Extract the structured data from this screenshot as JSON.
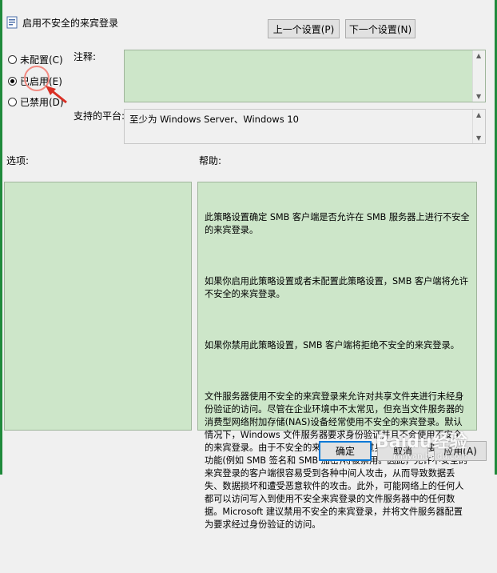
{
  "window": {
    "title": "启用不安全的来宾登录"
  },
  "nav": {
    "prev_label": "上一个设置(P)",
    "next_label": "下一个设置(N)"
  },
  "state": {
    "options": [
      {
        "label": "未配置(C)",
        "checked": false
      },
      {
        "label": "已启用(E)",
        "checked": true
      },
      {
        "label": "已禁用(D)",
        "checked": false
      }
    ]
  },
  "comment": {
    "label": "注释:"
  },
  "platform": {
    "label": "支持的平台:",
    "value": "至少为 Windows Server、Windows 10"
  },
  "options_section": {
    "label": "选项:"
  },
  "help_section": {
    "label": "帮助:",
    "paragraphs": [
      "此策略设置确定 SMB 客户端是否允许在 SMB 服务器上进行不安全的来宾登录。",
      "如果你启用此策略设置或者未配置此策略设置，SMB 客户端将允许不安全的来宾登录。",
      "如果你禁用此策略设置，SMB 客户端将拒绝不安全的来宾登录。",
      "文件服务器使用不安全的来宾登录来允许对共享文件夹进行未经身份验证的访问。尽管在企业环境中不太常见，但充当文件服务器的消费型网络附加存储(NAS)设备经常使用不安全的来宾登录。默认情况下，Windows 文件服务器要求身份验证并且不会使用不安全的来宾登录。由于不安全的来宾登录未经过身份验证，重要的安全功能(例如 SMB 签名和 SMB 加密)将被禁用。因此，允许不安全的来宾登录的客户端很容易受到各种中间人攻击，从而导致数据丢失、数据损坏和遭受恶意软件的攻击。此外，可能网络上的任何人都可以访问写入到使用不安全来宾登录的文件服务器中的任何数据。Microsoft 建议禁用不安全的来宾登录，并将文件服务器配置为要求经过身份验证的访问。"
    ]
  },
  "footer": {
    "ok_label": "确定",
    "cancel_label": "取消",
    "apply_label": "应用(A)"
  },
  "watermark": {
    "text": "Baidu经验",
    "sub": "jingyan.baidu.com"
  }
}
